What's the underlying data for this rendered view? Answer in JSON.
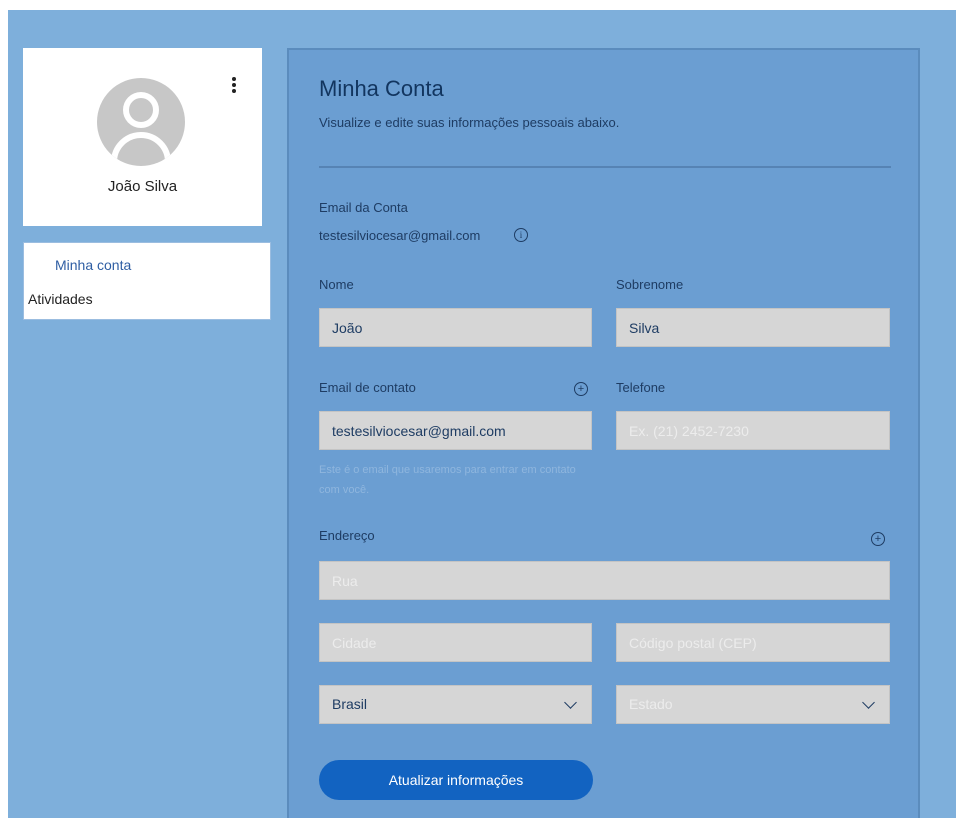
{
  "profile": {
    "name": "João Silva",
    "more_icon": "more-vertical-icon",
    "avatar_icon": "user-avatar-icon"
  },
  "sidebar": {
    "items": [
      {
        "label": "Minha conta",
        "active": true
      },
      {
        "label": "Atividades",
        "active": false
      }
    ]
  },
  "account": {
    "title": "Minha Conta",
    "subtitle": "Visualize e edite suas informações pessoais abaixo.",
    "account_email_label": "Email da Conta",
    "account_email_value": "testesilviocesar@gmail.com",
    "first_name_label": "Nome",
    "first_name_value": "João",
    "last_name_label": "Sobrenome",
    "last_name_value": "Silva",
    "contact_email_label": "Email de contato",
    "contact_email_value": "testesilviocesar@gmail.com",
    "contact_email_help": "Este é o email que usaremos para entrar em contato com você.",
    "phone_label": "Telefone",
    "phone_placeholder": "Ex. (21) 2452-7230",
    "address_label": "Endereço",
    "street_placeholder": "Rua",
    "city_placeholder": "Cidade",
    "zip_placeholder": "Código postal (CEP)",
    "country_value": "Brasil",
    "state_placeholder": "Estado",
    "submit_label": "Atualizar informações"
  },
  "colors": {
    "page_bg": "#7eafdb",
    "panel_bg": "#6b9ed2",
    "button": "#1263c1",
    "active_link": "#2f5ea3"
  }
}
